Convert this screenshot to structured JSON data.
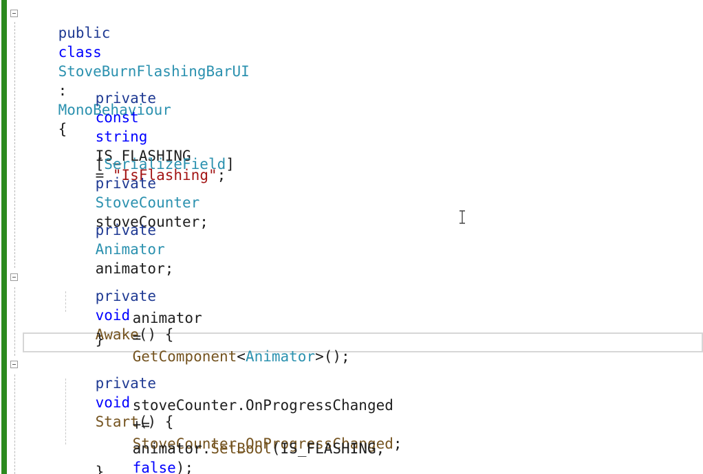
{
  "code": {
    "line1": {
      "public": "public",
      "class": "class",
      "class_name": "StoveBurnFlashingBarUI",
      "colon": ":",
      "base_class": "MonoBehaviour",
      "brace": "{"
    },
    "line2": {
      "private": "private",
      "const": "const",
      "string": "string",
      "name": "IS_FLASHING",
      "equals": "=",
      "value": "\"IsFlashing\"",
      "semicolon": ";"
    },
    "line3": {
      "open_bracket": "[",
      "attribute": "SerializeField",
      "close_bracket": "]",
      "private": "private",
      "type": "StoveCounter",
      "field": "stoveCounter;"
    },
    "line4": {
      "private": "private",
      "type": "Animator",
      "field": "animator;"
    },
    "line5": {
      "private": "private",
      "void": "void",
      "method": "Awake",
      "rest": "() {"
    },
    "line6": {
      "target": "animator",
      "assign": "=",
      "method": "GetComponent",
      "lt": "<",
      "type": "Animator",
      "gt": ">();"
    },
    "line7": {
      "brace": "}"
    },
    "line8": {
      "private": "private",
      "void": "void",
      "method": "Start",
      "rest": "() {"
    },
    "line9": {
      "target": "stoveCounter.OnProgressChanged",
      "op": "+=",
      "handler": "StoveCounter_OnProgressChanged",
      "semicolon": ";"
    },
    "line10": {
      "target": "animator.",
      "method": "SetBool",
      "open": "(IS_FLASHING,",
      "false": "false",
      "close": ");"
    },
    "line11": {
      "brace": "}"
    }
  },
  "colors": {
    "keyword": "#0000ff",
    "type": "#2b91af",
    "string": "#a31515",
    "method": "#74531f",
    "change_bar": "#2c8a1e"
  },
  "icons": {
    "cursor": "i-beam-cursor-icon",
    "fold": "collapse-minus-icon"
  }
}
